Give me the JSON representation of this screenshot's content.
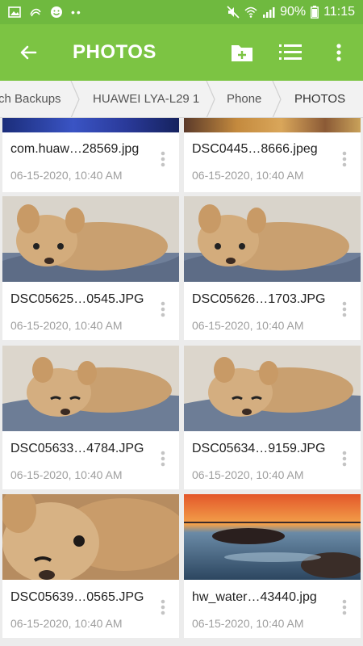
{
  "status": {
    "battery": "90%",
    "time": "11:15"
  },
  "appbar": {
    "title": "PHOTOS"
  },
  "breadcrumb": [
    "ch Backups",
    "HUAWEI LYA-L29 1",
    "Phone",
    "PHOTOS"
  ],
  "files": [
    {
      "name": "com.huaw…28569.jpg",
      "date": "06-15-2020, 10:40 AM"
    },
    {
      "name": "DSC0445…8666.jpeg",
      "date": "06-15-2020, 10:40 AM"
    },
    {
      "name": "DSC05625…0545.JPG",
      "date": "06-15-2020, 10:40 AM"
    },
    {
      "name": "DSC05626…1703.JPG",
      "date": "06-15-2020, 10:40 AM"
    },
    {
      "name": "DSC05633…4784.JPG",
      "date": "06-15-2020, 10:40 AM"
    },
    {
      "name": "DSC05634…9159.JPG",
      "date": "06-15-2020, 10:40 AM"
    },
    {
      "name": "DSC05639…0565.JPG",
      "date": "06-15-2020, 10:40 AM"
    },
    {
      "name": "hw_water…43440.jpg",
      "date": "06-15-2020, 10:40 AM"
    }
  ],
  "colors": {
    "appbar": "#7cc443",
    "statusbar": "#6fb93f"
  }
}
